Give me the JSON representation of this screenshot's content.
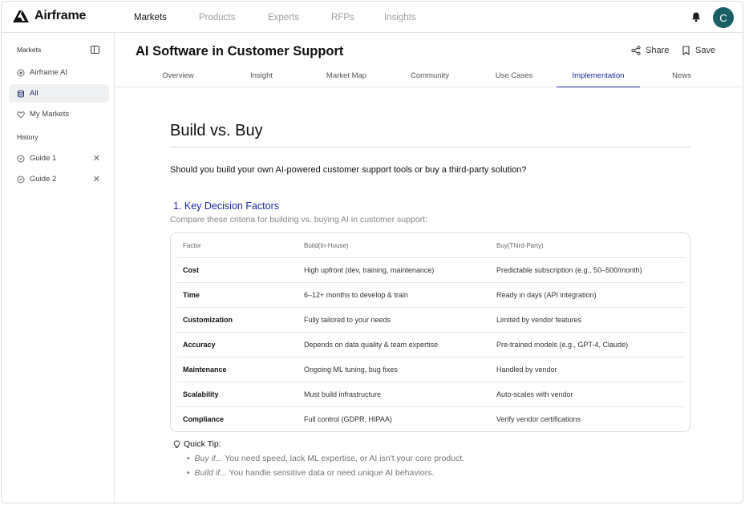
{
  "brand": {
    "name": "Airframe"
  },
  "topnav": [
    "Markets",
    "Products",
    "Experts",
    "RFPs",
    "Insights"
  ],
  "avatar_initial": "C",
  "sidebar": {
    "markets_heading": "Markets",
    "items": [
      {
        "label": "Airframe AI",
        "icon": "sparkle-icon"
      },
      {
        "label": "All",
        "icon": "database-icon"
      },
      {
        "label": "My Markets",
        "icon": "heart-icon"
      }
    ],
    "history_heading": "History",
    "history": [
      {
        "label": "Guide 1",
        "icon": "compass-icon"
      },
      {
        "label": "Guide 2",
        "icon": "compass-icon"
      }
    ]
  },
  "page": {
    "title": "AI Software in Customer Support",
    "share_label": "Share",
    "save_label": "Save",
    "tabs": [
      "Overview",
      "Insight",
      "Market Map",
      "Community",
      "Use Cases",
      "Implementation",
      "News"
    ]
  },
  "content": {
    "heading": "Build vs. Buy",
    "lead": "Should you build your own AI-powered customer support tools or buy a third-party solution?",
    "section_title": "1. Key Decision Factors",
    "section_sub": "Compare these criteria for building vs. buying AI in customer support:",
    "table": {
      "headers": [
        "Factor",
        "Build(In-House)",
        "Buy(Third-Party)"
      ],
      "rows": [
        [
          "Cost",
          "High upfront (dev, training, maintenance)",
          "Predictable subscription (e.g., 50–500/month)"
        ],
        [
          "Time",
          "6–12+ months to develop & train",
          "Ready in days (API integration)"
        ],
        [
          "Customization",
          "Fully tailored to your needs",
          "Limited by vendor features"
        ],
        [
          "Accuracy",
          "Depends on data quality & team expertise",
          "Pre-trained models (e.g., GPT-4, Claude)"
        ],
        [
          "Maintenance",
          "Ongoing ML tuning, bug fixes",
          "Handled by vendor"
        ],
        [
          "Scalability",
          "Must build infrastructure",
          "Auto-scales with vendor"
        ],
        [
          "Compliance",
          "Full control (GDPR, HIPAA)",
          "Verify vendor certifications"
        ]
      ]
    },
    "tip_title": "Quick Tip:",
    "tips": [
      {
        "lead": "Buy if...",
        "text": " You need speed, lack ML expertise, or AI isn't your core product."
      },
      {
        "lead": "Build if...",
        "text": " You handle sensitive data or need unique AI behaviors."
      }
    ]
  }
}
